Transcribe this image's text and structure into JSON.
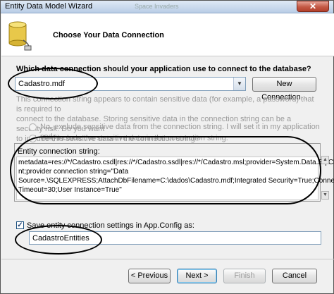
{
  "window": {
    "title": "Entity Data Model Wizard",
    "ghost_title": "Space Invaders"
  },
  "header": {
    "heading": "Choose Your Data Connection"
  },
  "connection": {
    "question": "Which data connection should your application use to connect to the database?",
    "selected": "Cadastro.mdf",
    "new_button": "New Connection..."
  },
  "sensitive": {
    "paragraph": [
      "This connection string appears to contain sensitive data (for example, a password) that is required to",
      "connect to the database. Storing sensitive data in the connection string can be a security risk. Do you want",
      "to include this sensitive data in the connection string?"
    ],
    "option_no": "No, exclude sensitive data from the connection string. I will set it in my application code.",
    "option_yes": "Yes, include the sensitive data in the connection string."
  },
  "entity_string": {
    "label": "Entity connection string:",
    "lines": [
      "metadata=res://*/Cadastro.csdl|res://*/Cadastro.ssdl|res://*/Cadastro.msl;provider=System.Data.SqlClie",
      "nt;provider connection string=\"Data",
      "Source=.\\SQLEXPRESS;AttachDbFilename=C:\\dados\\Cadastro.mdf;Integrated Security=True;Connect",
      "Timeout=30;User Instance=True\""
    ]
  },
  "save": {
    "checked": true,
    "label": "Save entity connection settings in App.Config as:",
    "name": "CadastroEntities"
  },
  "buttons": {
    "previous": "< Previous",
    "next": "Next >",
    "finish": "Finish",
    "cancel": "Cancel"
  }
}
